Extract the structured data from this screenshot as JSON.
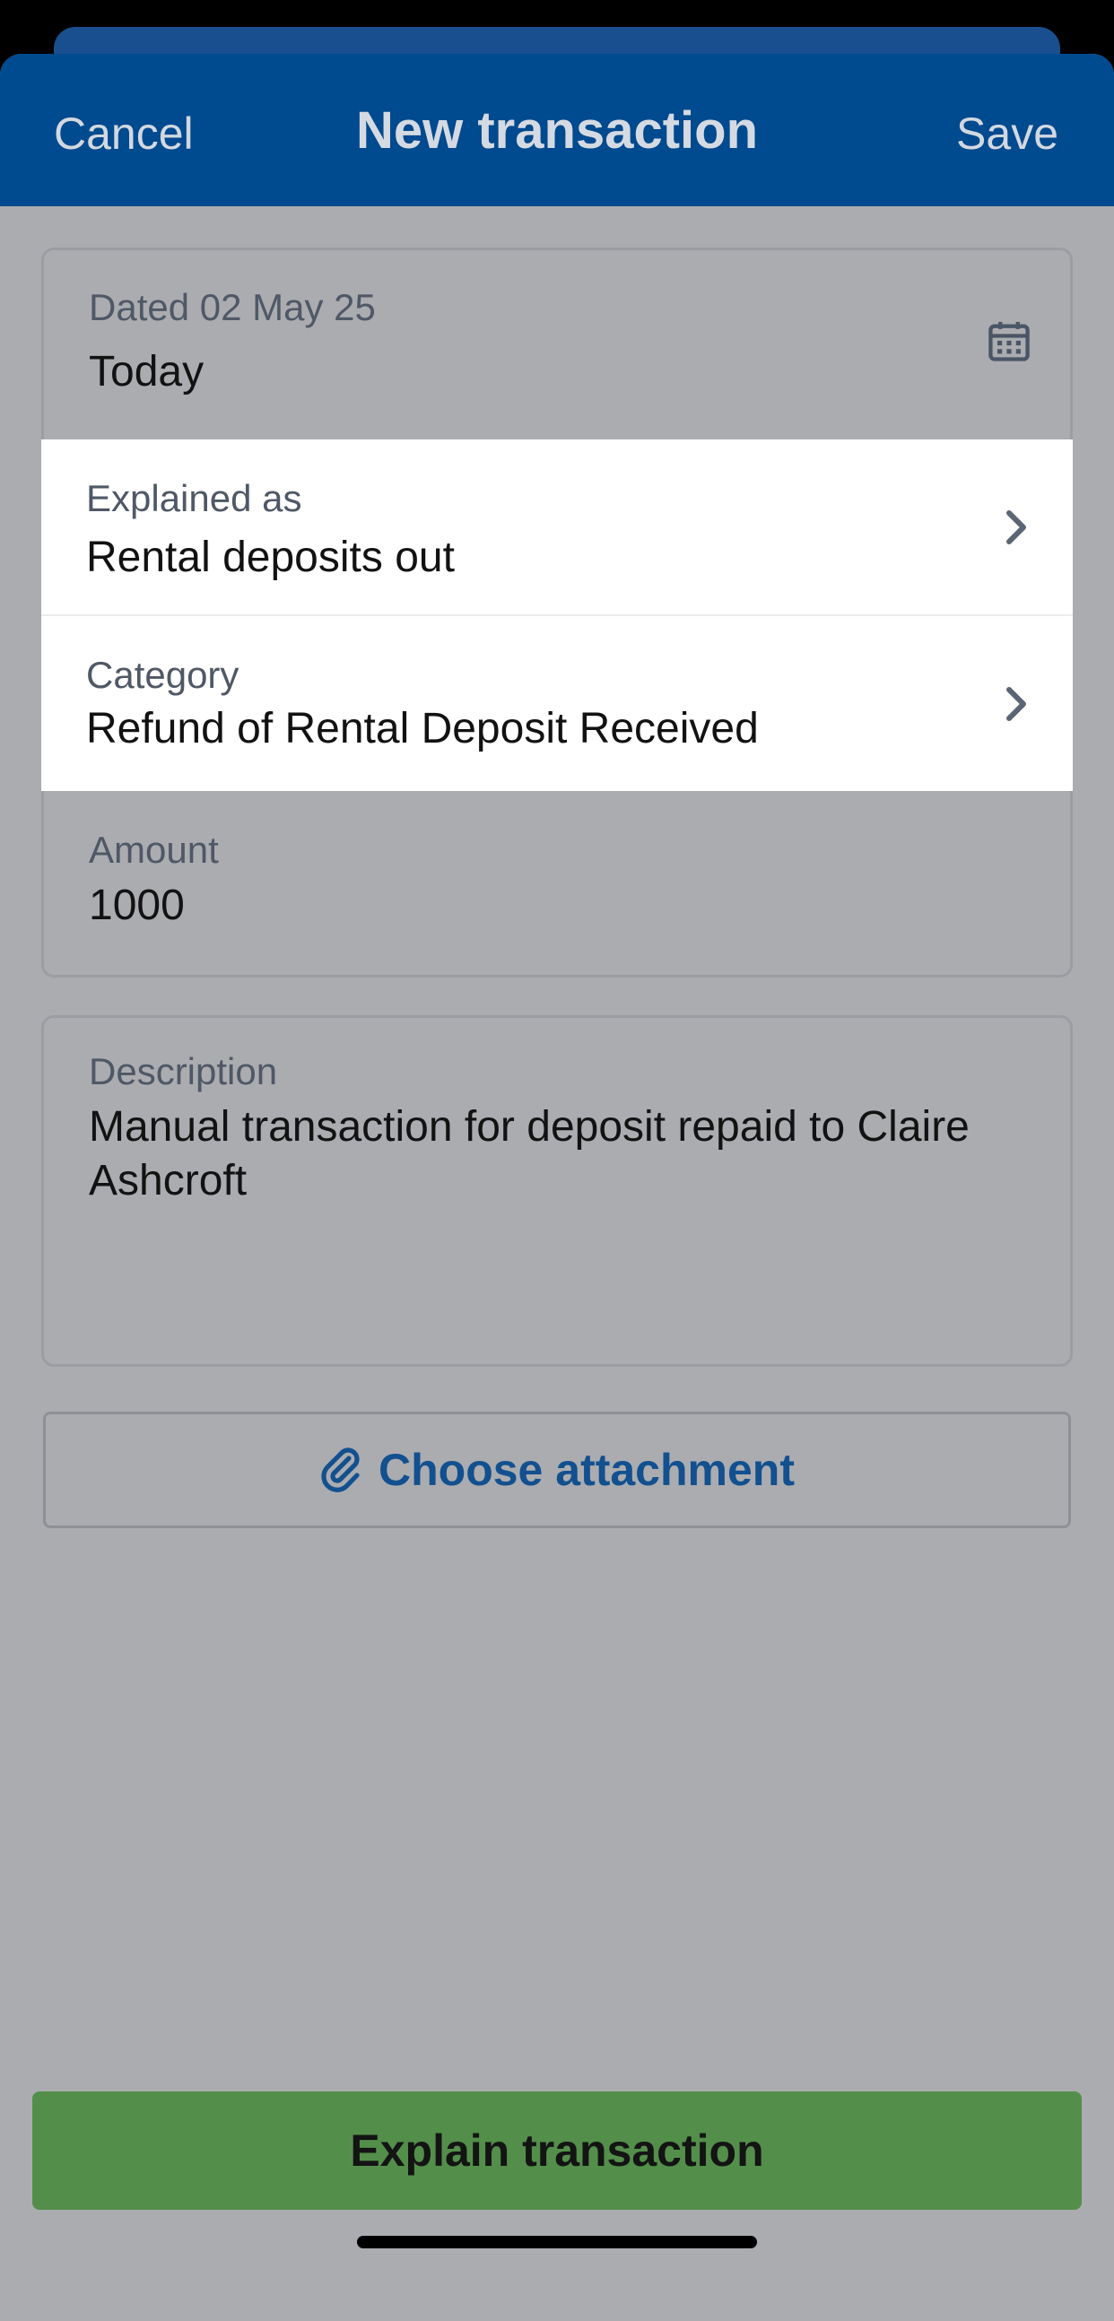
{
  "nav": {
    "cancel": "Cancel",
    "title": "New transaction",
    "save": "Save"
  },
  "date": {
    "label": "Dated 02 May 25",
    "value": "Today",
    "icon": "calendar-icon"
  },
  "explained_as": {
    "label": "Explained as",
    "value": "Rental deposits out",
    "icon": "chevron-right-icon"
  },
  "category": {
    "label": "Category",
    "value": "Refund of Rental Deposit Received",
    "icon": "chevron-right-icon"
  },
  "amount": {
    "label": "Amount",
    "value": "1000"
  },
  "description": {
    "label": "Description",
    "value": "Manual transaction for deposit repaid to Claire Ashcroft"
  },
  "attachment": {
    "label": "Choose attachment",
    "icon": "paperclip-icon"
  },
  "explain_button": {
    "label": "Explain transaction"
  },
  "colors": {
    "nav_bar": "#004a8f",
    "accent_text": "#12508f",
    "primary_button": "#538f4a",
    "overlay_background": "#abacb0"
  }
}
